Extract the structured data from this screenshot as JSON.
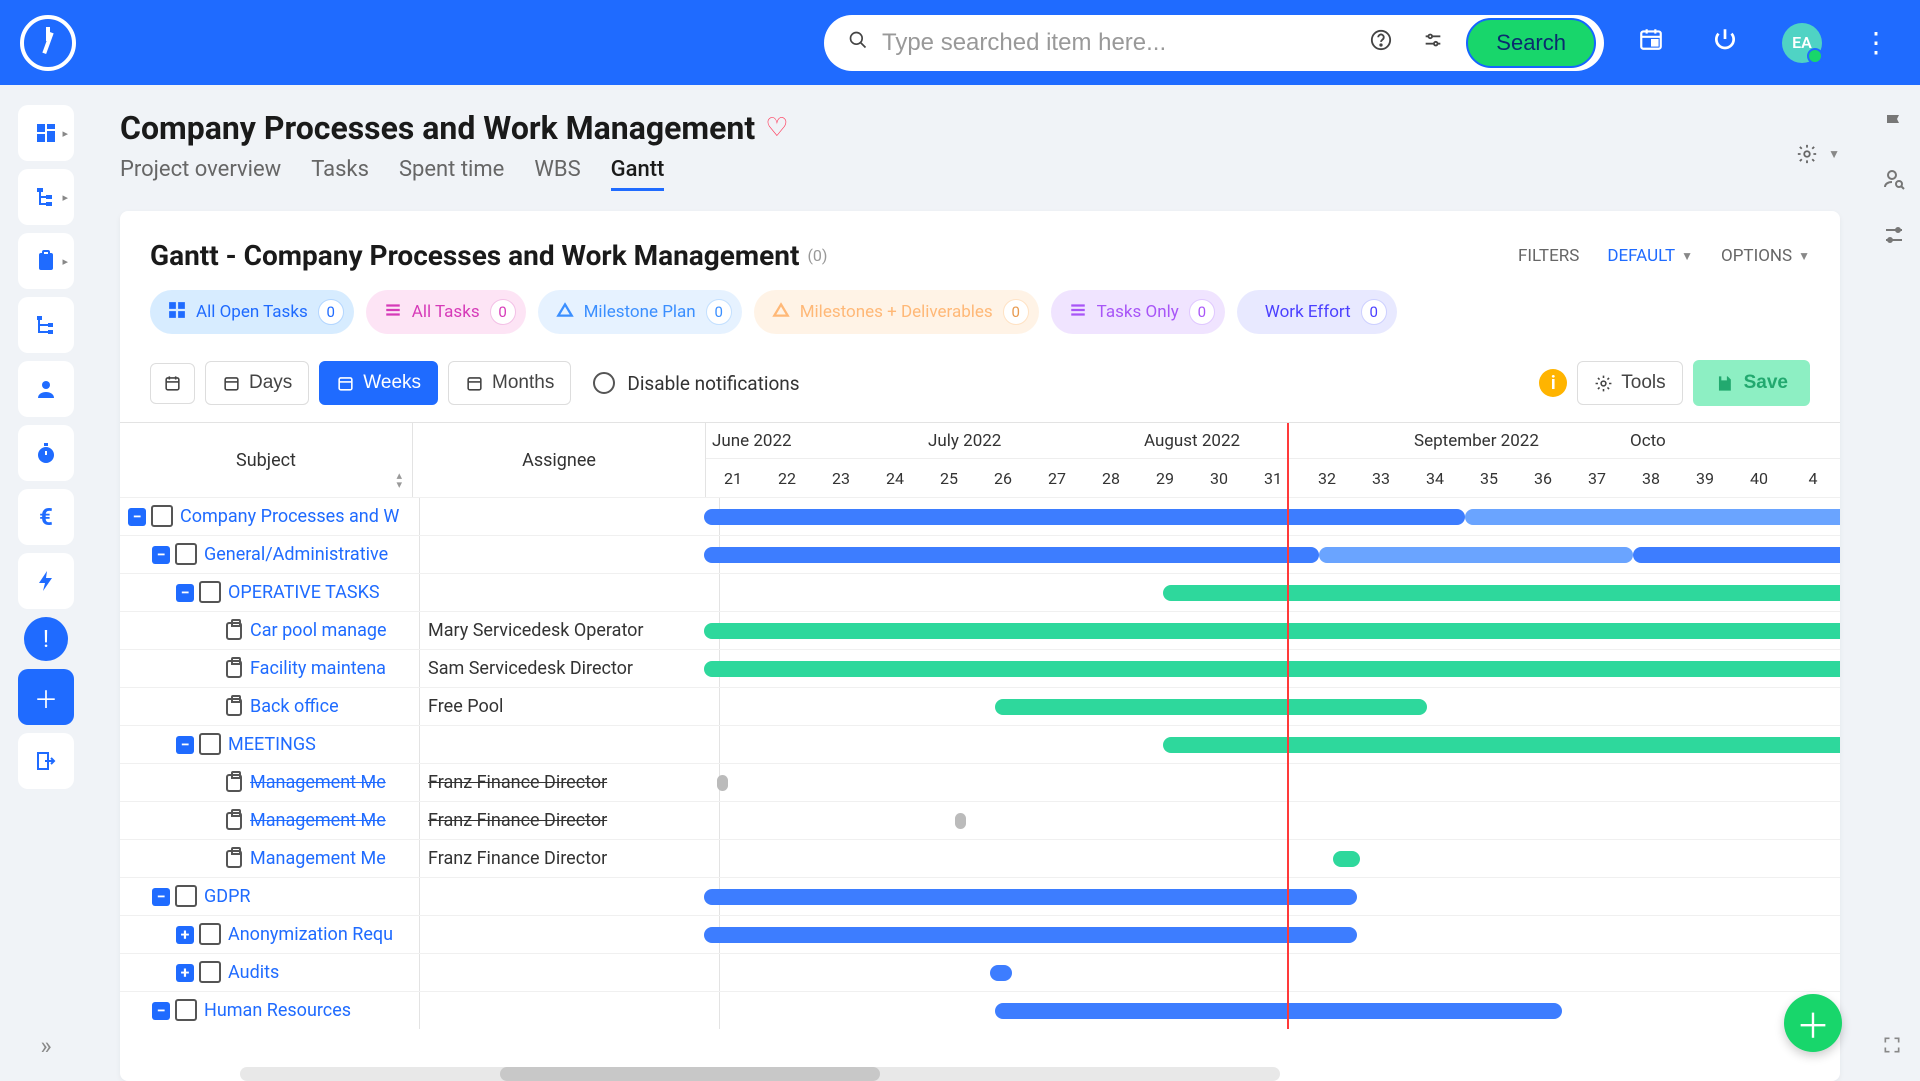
{
  "header": {
    "search_placeholder": "Type searched item here...",
    "search_button": "Search",
    "avatar_initials": "EA"
  },
  "page": {
    "title": "Company Processes and Work Management",
    "tabs": [
      "Project overview",
      "Tasks",
      "Spent time",
      "WBS",
      "Gantt"
    ],
    "active_tab": 4
  },
  "panel": {
    "title": "Gantt - Company Processes and Work Management",
    "count": "(0)",
    "filters_label": "FILTERS",
    "filters_value": "DEFAULT",
    "options_label": "OPTIONS"
  },
  "pills": [
    {
      "label": "All Open Tasks",
      "count": "0",
      "cls": "cyan",
      "icon": "grid"
    },
    {
      "label": "All Tasks",
      "count": "0",
      "cls": "pink",
      "icon": "list"
    },
    {
      "label": "Milestone Plan",
      "count": "0",
      "cls": "blue2",
      "icon": "tri"
    },
    {
      "label": "Milestones + Deliverables",
      "count": "0",
      "cls": "orange",
      "icon": "tri"
    },
    {
      "label": "Tasks Only",
      "count": "0",
      "cls": "purple",
      "icon": "list"
    },
    {
      "label": "Work Effort",
      "count": "0",
      "cls": "indigo",
      "icon": "dot"
    }
  ],
  "toolbar": {
    "days": "Days",
    "weeks": "Weeks",
    "months": "Months",
    "disable_notifications": "Disable notifications",
    "tools": "Tools",
    "save": "Save"
  },
  "columns": {
    "subject": "Subject",
    "assignee": "Assignee"
  },
  "timeline": {
    "months": [
      {
        "label": "June 2022",
        "weeks": 4
      },
      {
        "label": "July 2022",
        "weeks": 4
      },
      {
        "label": "August 2022",
        "weeks": 5
      },
      {
        "label": "September 2022",
        "weeks": 4
      },
      {
        "label": "Octo",
        "weeks": 1
      }
    ],
    "weeks": [
      "21",
      "22",
      "23",
      "24",
      "25",
      "26",
      "27",
      "28",
      "29",
      "30",
      "31",
      "32",
      "33",
      "34",
      "35",
      "36",
      "37",
      "38",
      "39",
      "40",
      "4"
    ],
    "today_week_index": 10.5
  },
  "rows": [
    {
      "indent": 0,
      "toggle": "-",
      "icon": "stack",
      "subject": "Company Processes and W",
      "assignee": "",
      "link": true,
      "bars": [
        {
          "cls": "blue",
          "start": -1,
          "end": 13.8
        },
        {
          "cls": "blue2",
          "start": 13.8,
          "end": 21
        }
      ]
    },
    {
      "indent": 1,
      "toggle": "-",
      "icon": "stack",
      "subject": "General/Administrative",
      "assignee": "",
      "link": true,
      "bars": [
        {
          "cls": "blue",
          "start": -1,
          "end": 11.1
        },
        {
          "cls": "blue2",
          "start": 11.1,
          "end": 16.9
        },
        {
          "cls": "blue",
          "start": 16.9,
          "end": 21
        }
      ]
    },
    {
      "indent": 2,
      "toggle": "-",
      "icon": "stack",
      "subject": "OPERATIVE TASKS",
      "assignee": "",
      "link": true,
      "bars": [
        {
          "cls": "green open-end",
          "start": 8.2,
          "end": 21
        }
      ]
    },
    {
      "indent": 3,
      "toggle": "",
      "icon": "clip",
      "subject": "Car pool manage",
      "assignee": "Mary Servicedesk Operator",
      "link": true,
      "bars": [
        {
          "cls": "green open-end",
          "start": -1,
          "end": 21
        }
      ]
    },
    {
      "indent": 3,
      "toggle": "",
      "icon": "clip",
      "subject": "Facility maintena",
      "assignee": "Sam Servicedesk Director",
      "link": true,
      "bars": [
        {
          "cls": "green open-end",
          "start": -1,
          "end": 21
        }
      ]
    },
    {
      "indent": 3,
      "toggle": "",
      "icon": "clip",
      "subject": "Back office",
      "assignee": "Free Pool",
      "link": true,
      "bars": [
        {
          "cls": "green",
          "start": 5.1,
          "end": 13.1
        }
      ]
    },
    {
      "indent": 2,
      "toggle": "-",
      "icon": "stack",
      "subject": "MEETINGS",
      "assignee": "",
      "link": true,
      "bars": [
        {
          "cls": "green open-end",
          "start": 8.2,
          "end": 21
        }
      ]
    },
    {
      "indent": 3,
      "toggle": "",
      "icon": "clip",
      "subject": "Management Me",
      "assignee": "Franz Finance Director",
      "link": true,
      "strike": true,
      "bars": [
        {
          "cls": "grey",
          "start": -0.05,
          "end": 0.15
        }
      ]
    },
    {
      "indent": 3,
      "toggle": "",
      "icon": "clip",
      "subject": "Management Me",
      "assignee": "Franz Finance Director",
      "link": true,
      "strike": true,
      "bars": [
        {
          "cls": "grey",
          "start": 4.36,
          "end": 4.55
        }
      ]
    },
    {
      "indent": 3,
      "toggle": "",
      "icon": "clip",
      "subject": "Management Me",
      "assignee": "Franz Finance Director",
      "link": true,
      "bars": [
        {
          "cls": "green",
          "start": 11.35,
          "end": 11.85
        }
      ]
    },
    {
      "indent": 1,
      "toggle": "-",
      "icon": "stack",
      "subject": "GDPR",
      "assignee": "",
      "link": true,
      "bars": [
        {
          "cls": "blue",
          "start": -1,
          "end": 11.8
        }
      ]
    },
    {
      "indent": 2,
      "toggle": "+",
      "icon": "stack",
      "subject": "Anonymization Requ",
      "assignee": "",
      "link": true,
      "bars": [
        {
          "cls": "blue",
          "start": -1,
          "end": 11.8
        }
      ]
    },
    {
      "indent": 2,
      "toggle": "+",
      "icon": "stack",
      "subject": "Audits",
      "assignee": "",
      "link": true,
      "bars": [
        {
          "cls": "blue",
          "start": 5.0,
          "end": 5.4
        }
      ]
    },
    {
      "indent": 1,
      "toggle": "-",
      "icon": "stack",
      "subject": "Human Resources",
      "assignee": "",
      "link": true,
      "bars": [
        {
          "cls": "blue",
          "start": 5.1,
          "end": 15.6
        }
      ]
    }
  ]
}
